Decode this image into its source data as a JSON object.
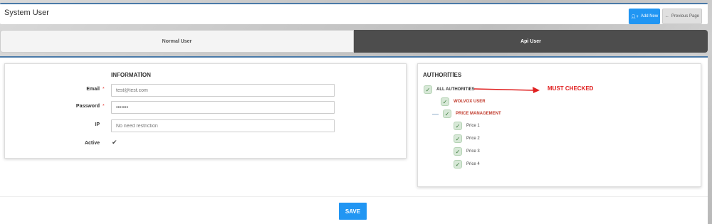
{
  "header": {
    "title": "System User",
    "add_new_label": "Add New",
    "previous_page_label": "Previous Page"
  },
  "tabs": [
    {
      "label": "Normal User",
      "active": false
    },
    {
      "label": "Api User",
      "active": true
    }
  ],
  "information": {
    "heading": "INFORMATİON",
    "fields": {
      "email": {
        "label": "Email",
        "required_mark": "*",
        "placeholder": "test@test.com"
      },
      "password": {
        "label": "Password",
        "required_mark": "*",
        "value": "1234567"
      },
      "ip": {
        "label": "IP",
        "placeholder": "No need restriction"
      },
      "active": {
        "label": "Active",
        "checked": true
      }
    }
  },
  "authorities": {
    "heading": "AUTHORİTİES",
    "items": [
      {
        "label": "ALL AUTHORITIES",
        "checked": true
      },
      {
        "label": "WOLVOX USER",
        "checked": true
      },
      {
        "label": "PRICE MANAGEMENT",
        "checked": true,
        "expanded": true
      },
      {
        "label": "Price 1",
        "checked": true
      },
      {
        "label": "Price 2",
        "checked": true
      },
      {
        "label": "Price 3",
        "checked": true
      },
      {
        "label": "Price 4",
        "checked": true
      }
    ],
    "annotation": "MUST CHECKED"
  },
  "footer": {
    "save_label": "SAVE"
  },
  "colors": {
    "accent_blue": "#2196f3",
    "tab_active_bg": "#4d4d4d",
    "check_green": "#3b7a3b",
    "annotation_red": "#e02020"
  }
}
